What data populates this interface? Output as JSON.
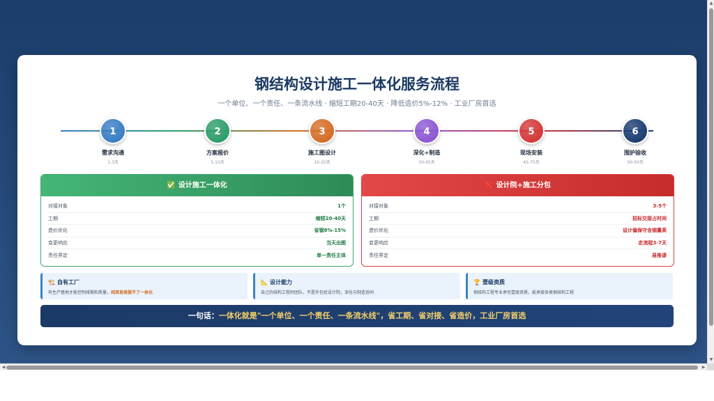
{
  "page": {
    "title": "钢结构设计施工一体化服务流程",
    "subtitle": "一个单位、一个责任、一条流水线 · 缩短工期20-40天 · 降低造价5%-12% · 工业厂房首选"
  },
  "steps": [
    {
      "num": "1",
      "name": "需求沟通",
      "days": "1-3天",
      "color": "#3b7fc4"
    },
    {
      "num": "2",
      "name": "方案报价",
      "days": "5-10天",
      "color": "#2f9f6b"
    },
    {
      "num": "3",
      "name": "施工图设计",
      "days": "10-20天",
      "color": "#d66f2a"
    },
    {
      "num": "4",
      "name": "深化+制造",
      "days": "30-45天",
      "color": "#8e5ad3"
    },
    {
      "num": "5",
      "name": "现场安装",
      "days": "45-75天",
      "color": "#d43a3a"
    },
    {
      "num": "6",
      "name": "围护验收",
      "days": "30-50天",
      "color": "#1d3f73"
    }
  ],
  "panels": {
    "integrated": {
      "icon": "✅",
      "title": "设计施工一体化",
      "rows": [
        {
          "label": "对接对象",
          "value": "1个"
        },
        {
          "label": "工期",
          "value": "缩短20-40天"
        },
        {
          "label": "造价优化",
          "value": "省钢8%-15%"
        },
        {
          "label": "变更响应",
          "value": "当天出图"
        },
        {
          "label": "责任界定",
          "value": "单一责任主体"
        }
      ]
    },
    "separate": {
      "icon": "❌",
      "title": "设计院+施工分包",
      "rows": [
        {
          "label": "对接对象",
          "value": "3-5个"
        },
        {
          "label": "工期",
          "value": "招标交接占时间"
        },
        {
          "label": "造价优化",
          "value": "设计偏保守含钢量高"
        },
        {
          "label": "变更响应",
          "value": "走流程3-7天"
        },
        {
          "label": "责任界定",
          "value": "易推诿"
        }
      ]
    }
  },
  "features": [
    {
      "icon": "🏗️",
      "title": "自有工厂",
      "desc": "有生产基地才能控制排期和质量，",
      "highlight": "纯贸易商做不了一体化"
    },
    {
      "icon": "📐",
      "title": "设计能力",
      "desc": "自己的结构工程师团队，不是外包给设计院，深化与制造协同",
      "highlight": ""
    },
    {
      "icon": "🏆",
      "title": "壹级资质",
      "desc": "钢结构工程专业承包壹级资质，能承接各类钢结构工程",
      "highlight": ""
    }
  ],
  "summary": {
    "prefix": "一句话：",
    "body": "一体化就是\"一个单位、一个责任、一条流水线\"，省工期、省对接、省造价，工业厂房首选"
  },
  "colors": {
    "background": "#1c3d6b",
    "green": "#2e8b57",
    "red": "#d43a3a",
    "navy": "#1b3a63",
    "gold": "#f5d06a"
  }
}
